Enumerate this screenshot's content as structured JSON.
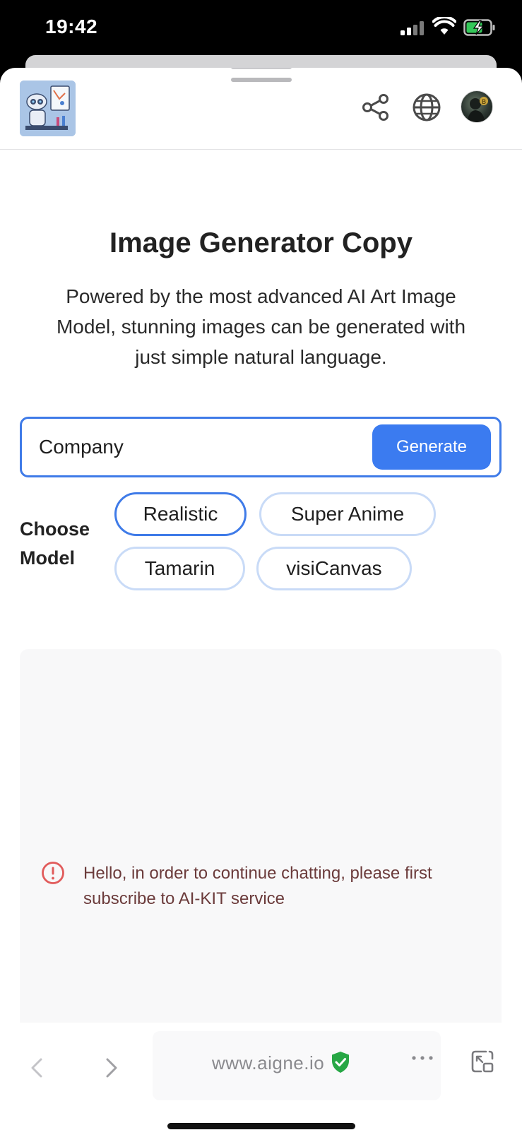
{
  "status_bar": {
    "time": "19:42"
  },
  "app": {
    "title": "Image Generator Copy",
    "subtitle": "Powered by the most advanced AI Art Image Model, stunning images can be generated with just simple natural language."
  },
  "prompt": {
    "value": "Company",
    "generate_label": "Generate"
  },
  "models": {
    "label": "Choose Model",
    "options": [
      "Realistic",
      "Super Anime",
      "Tamarin",
      "visiCanvas"
    ],
    "selected": "Realistic"
  },
  "message": {
    "text": "Hello, in order to continue chatting, please first subscribe to AI-KIT service"
  },
  "browser": {
    "url": "www.aigne.io"
  },
  "colors": {
    "accent": "#3b7bf0",
    "error": "#e15b5b",
    "secure": "#27a745"
  },
  "icons": [
    "share-icon",
    "globe-icon",
    "warning-icon",
    "shield-check-icon",
    "back-icon",
    "forward-icon",
    "more-icon",
    "resize-icon"
  ]
}
